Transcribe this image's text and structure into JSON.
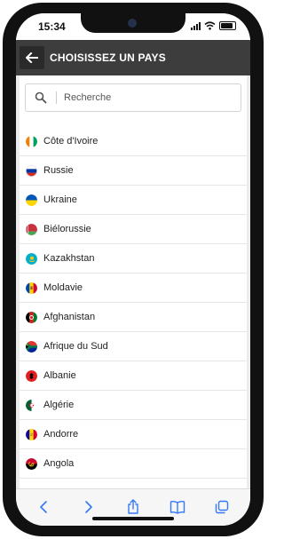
{
  "status_bar": {
    "time": "15:34"
  },
  "header": {
    "title": "CHOISISSEZ UN PAYS"
  },
  "search": {
    "placeholder": "Recherche"
  },
  "countries": [
    "Côte d'Ivoire",
    "Russie",
    "Ukraine",
    "Biélorussie",
    "Kazakhstan",
    "Moldavie",
    "Afghanistan",
    "Afrique du Sud",
    "Albanie",
    "Algérie",
    "Andorre",
    "Angola"
  ],
  "flag_colors": {
    "cote_divoire": [
      "#f77f00",
      "#ffffff",
      "#009e60"
    ],
    "russie": [
      "#ffffff",
      "#0039a6",
      "#d52b1e"
    ],
    "ukraine": [
      "#0057b7",
      "#ffd700"
    ],
    "bielorussie": [
      "#c8313e",
      "#4aa657"
    ],
    "kazakhstan": [
      "#00afca",
      "#fec50c"
    ],
    "moldavie": [
      "#0046ae",
      "#ffd200",
      "#cc092f"
    ],
    "afghanistan": [
      "#000000",
      "#d32011",
      "#007a36"
    ],
    "afrique_du_sud": [
      "#de3831",
      "#002395",
      "#007a4d",
      "#ffb612"
    ],
    "albanie": [
      "#e41e20",
      "#000000"
    ],
    "algerie": [
      "#006233",
      "#ffffff",
      "#d21034"
    ],
    "andorre": [
      "#10069f",
      "#fedd00",
      "#d50032"
    ],
    "angola": [
      "#cc092f",
      "#000000",
      "#ffcb00"
    ]
  },
  "browser_toolbar": {
    "icons": [
      "back-icon",
      "forward-icon",
      "share-icon",
      "bookmarks-icon",
      "tabs-icon"
    ],
    "accent": "#3478f6"
  }
}
